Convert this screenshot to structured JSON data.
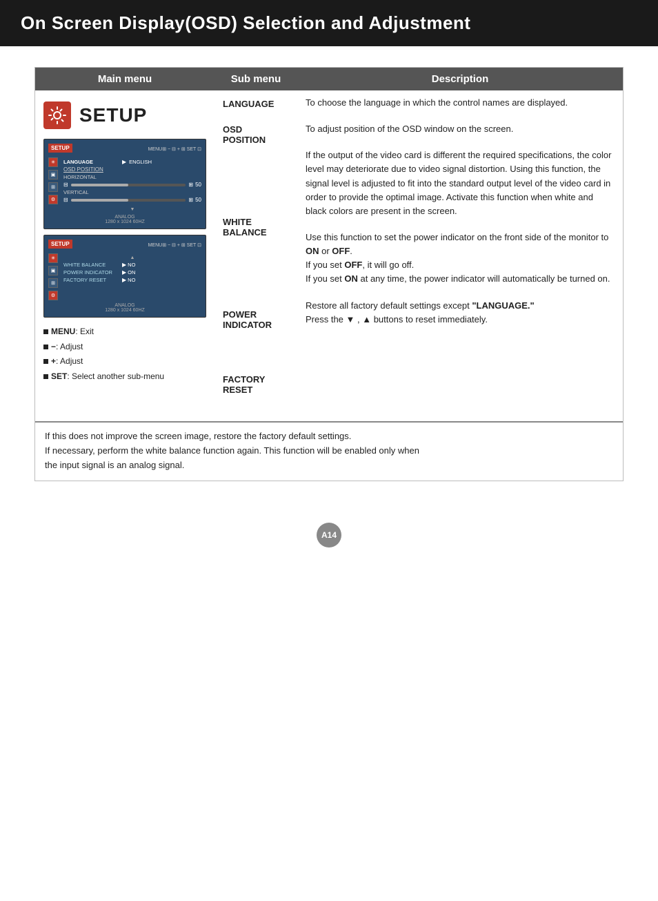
{
  "header": {
    "title": "On Screen Display(OSD) Selection and Adjustment"
  },
  "table": {
    "columns": [
      "Main menu",
      "Sub menu",
      "Description"
    ],
    "setup_title": "SETUP",
    "setup_icon": "⚙",
    "osd1": {
      "tag": "SETUP",
      "items": [
        {
          "label": "LANGUAGE",
          "value": "ENGLISH",
          "arrow": true
        },
        {
          "label": "OSD POSITION",
          "value": "",
          "section": true
        },
        {
          "label": "HORIZONTAL",
          "slider": true,
          "val": "50"
        },
        {
          "label": "VERTICAL",
          "slider": true,
          "val": "50"
        }
      ],
      "bottom": "ANALOG\n1280 x 1024  60HZ"
    },
    "osd2": {
      "tag": "SETUP",
      "items": [
        {
          "label": "WHITE BALANCE",
          "value": "NO"
        },
        {
          "label": "POWER INDICATOR",
          "value": "ON"
        },
        {
          "label": "FACTORY RESET",
          "value": "NO"
        }
      ],
      "bottom": "ANALOG\n1280 x 1024  60HZ"
    },
    "bullets": [
      {
        "icon": "■",
        "label": "MENU",
        "text": ": Exit"
      },
      {
        "icon": "■",
        "label": "−",
        "text": ": Adjust"
      },
      {
        "icon": "■",
        "label": "+",
        "text": ": Adjust"
      },
      {
        "icon": "■",
        "label": "SET",
        "text": ": Select another sub-menu"
      }
    ],
    "submenus": [
      {
        "label": "LANGUAGE"
      },
      {
        "label": "OSD\nPOSITION"
      },
      {
        "label": "WHITE\nBALANCE"
      },
      {
        "label": "POWER\nINDICATOR"
      },
      {
        "label": "FACTORY\nRESET"
      }
    ],
    "descriptions": [
      {
        "text": "To choose the language in which the control names are displayed."
      },
      {
        "text": "To adjust position of the OSD window on the screen."
      },
      {
        "parts": [
          {
            "type": "text",
            "content": "If the output of the video card is different the required specifications, the color level may deteriorate due to video signal distortion. Using this function, the signal level is adjusted to fit into the standard output level of the video card in order to provide the optimal image. Activate this function when white and black colors are present in the screen."
          }
        ]
      },
      {
        "parts": [
          {
            "type": "text",
            "content": "Use this function to set the power indicator on the front side of the monitor to "
          },
          {
            "type": "bold",
            "content": "ON"
          },
          {
            "type": "text",
            "content": " or "
          },
          {
            "type": "bold",
            "content": "OFF"
          },
          {
            "type": "text",
            "content": ".\nIf you set "
          },
          {
            "type": "bold",
            "content": "OFF"
          },
          {
            "type": "text",
            "content": ", it will go off.\nIf you set "
          },
          {
            "type": "bold",
            "content": "ON"
          },
          {
            "type": "text",
            "content": " at any time, the power indicator will automatically be turned on."
          }
        ]
      },
      {
        "parts": [
          {
            "type": "text",
            "content": "Restore all factory default settings except "
          },
          {
            "type": "bold",
            "content": "\"LANGUAGE.\""
          },
          {
            "type": "text",
            "content": "\nPress the ▼ , ▲ buttons to reset immediately."
          }
        ]
      }
    ]
  },
  "footer": {
    "note1": "If this does not improve the screen image, restore the factory default settings.",
    "note2": "If necessary, perform the white balance function again. This function will be enabled only when",
    "note3": "the input signal is an analog signal."
  },
  "page_number": "A14"
}
